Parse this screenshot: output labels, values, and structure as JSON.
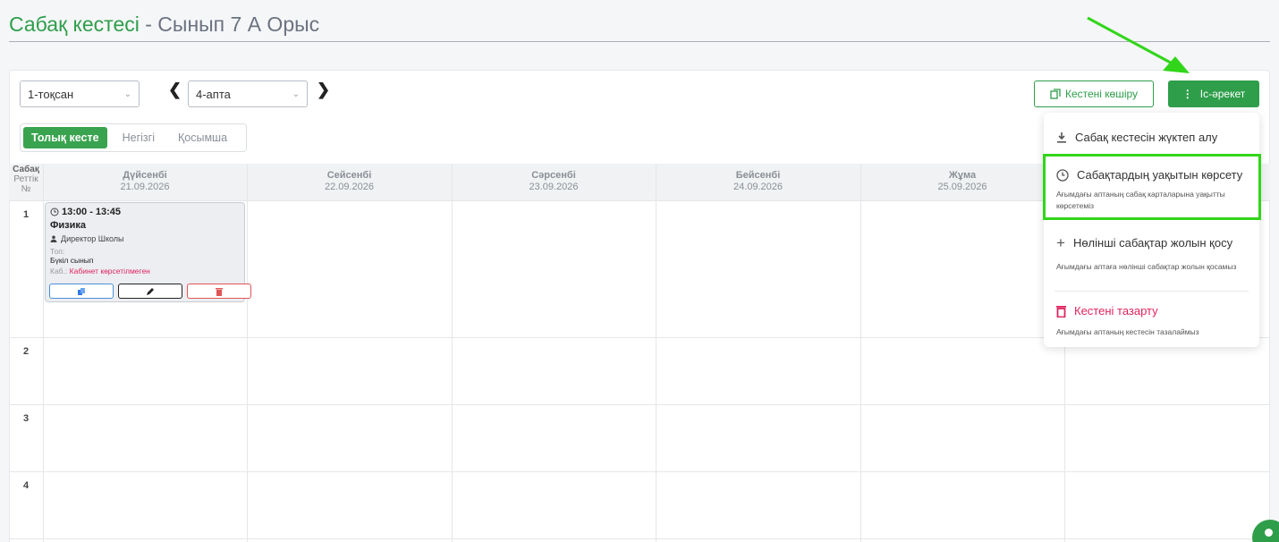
{
  "page": {
    "title_main": "Сабақ кестесі",
    "title_sep": " - ",
    "title_class": "Сынып 7 А Орыс"
  },
  "toolbar": {
    "quarter_select": "1-тоқсан",
    "week_select": "4-апта",
    "copy_button": "Кестені көшіру",
    "action_button": "Іс-әрекет"
  },
  "tabs": [
    {
      "label": "Толық кесте",
      "active": true
    },
    {
      "label": "Негізгі",
      "active": false
    },
    {
      "label": "Қосымша",
      "active": false
    }
  ],
  "grid": {
    "row_header": {
      "line1": "Сабақ",
      "line2": "Реттік",
      "line3": "№"
    },
    "days": [
      {
        "name": "Дүйсенбі",
        "date": "21.09.2026"
      },
      {
        "name": "Сейсенбі",
        "date": "22.09.2026"
      },
      {
        "name": "Сәрсенбі",
        "date": "23.09.2026"
      },
      {
        "name": "Бейсенбі",
        "date": "24.09.2026"
      },
      {
        "name": "Жұма",
        "date": "25.09.2026"
      }
    ],
    "rows": [
      "1",
      "2",
      "3",
      "4"
    ]
  },
  "lesson": {
    "time": "13:00 - 13:45",
    "subject": "Физика",
    "teacher": "Директор Школы",
    "group_label": "Топ:",
    "group_value": "Бүкіл сынып",
    "room_label": "Каб.:",
    "room_value": "Кабинет көрсетілмеген"
  },
  "menu": {
    "download": {
      "label": "Сабақ кестесін жүктеп алу"
    },
    "show_time": {
      "label": "Сабақтардың уақытын көрсету",
      "desc": "Ағымдағы аптаның сабақ карталарына уақытты көрсетеміз"
    },
    "add_zero": {
      "label": "Нөлінші сабақтар жолын қосу",
      "desc": "Ағымдағы аптаға нөлінші сабақтар жолын қосамыз"
    },
    "clear": {
      "label": "Кестені тазарту",
      "desc": "Ағымдағы аптаның кестесін тазалаймыз"
    }
  },
  "colors": {
    "accent": "#2e9e4a",
    "highlight": "#31d61a",
    "danger": "#e0245e"
  }
}
